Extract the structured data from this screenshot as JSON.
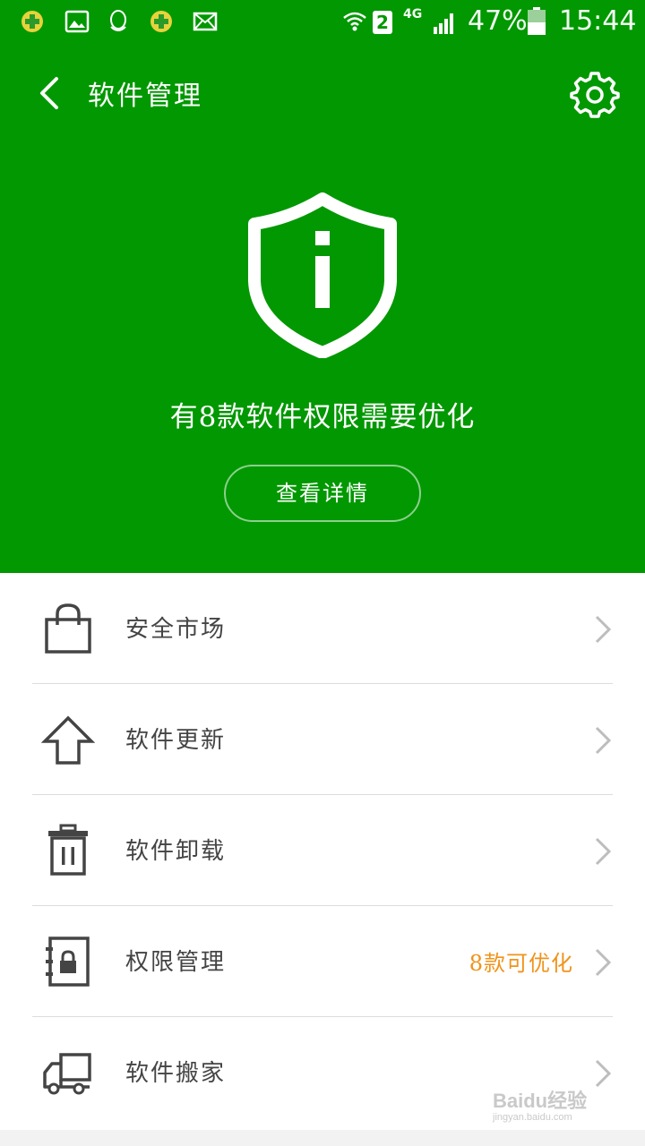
{
  "status_bar": {
    "battery": "47%",
    "time": "15:44",
    "network": "4G",
    "sim": "2",
    "notification_icons": [
      "360-icon",
      "gallery-icon",
      "qq-icon",
      "360-icon",
      "mail-icon"
    ]
  },
  "header": {
    "title": "软件管理",
    "back_icon": "back-arrow-icon",
    "settings_icon": "gear-icon"
  },
  "hero": {
    "icon": "shield-info-icon",
    "headline": "有8款软件权限需要优化",
    "button_label": "查看详情"
  },
  "menu": {
    "items": [
      {
        "label": "安全市场",
        "icon": "shopping-bag-icon",
        "badge": ""
      },
      {
        "label": "软件更新",
        "icon": "upload-arrow-icon",
        "badge": ""
      },
      {
        "label": "软件卸载",
        "icon": "trash-icon",
        "badge": ""
      },
      {
        "label": "权限管理",
        "icon": "lock-book-icon",
        "badge": "8款可优化"
      },
      {
        "label": "软件搬家",
        "icon": "truck-icon",
        "badge": ""
      }
    ]
  },
  "watermark": {
    "text": "Baidu经验",
    "sub": "jingyan.baidu.com"
  },
  "colors": {
    "header_bg": "#029802",
    "badge": "#f0931a",
    "row_text": "#444444",
    "divider": "#dcdcdc"
  }
}
